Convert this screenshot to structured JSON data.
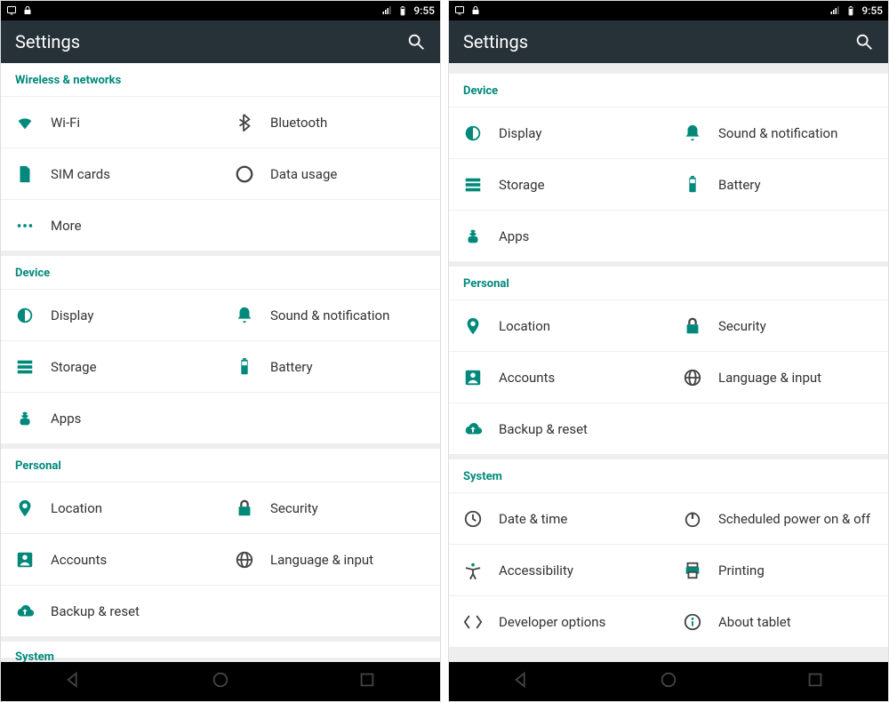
{
  "status": {
    "time": "9:55"
  },
  "app": {
    "title": "Settings"
  },
  "sections": {
    "wireless": {
      "header": "Wireless & networks",
      "wifi": "Wi-Fi",
      "bluetooth": "Bluetooth",
      "sim": "SIM cards",
      "data": "Data usage",
      "more": "More"
    },
    "device": {
      "header": "Device",
      "display": "Display",
      "sound": "Sound & notification",
      "storage": "Storage",
      "battery": "Battery",
      "apps": "Apps"
    },
    "personal": {
      "header": "Personal",
      "location": "Location",
      "security": "Security",
      "accounts": "Accounts",
      "language": "Language & input",
      "backup": "Backup & reset"
    },
    "system": {
      "header": "System",
      "datetime": "Date & time",
      "scheduled": "Scheduled power on & off",
      "accessibility": "Accessibility",
      "printing": "Printing",
      "developer": "Developer options",
      "about": "About tablet"
    }
  }
}
